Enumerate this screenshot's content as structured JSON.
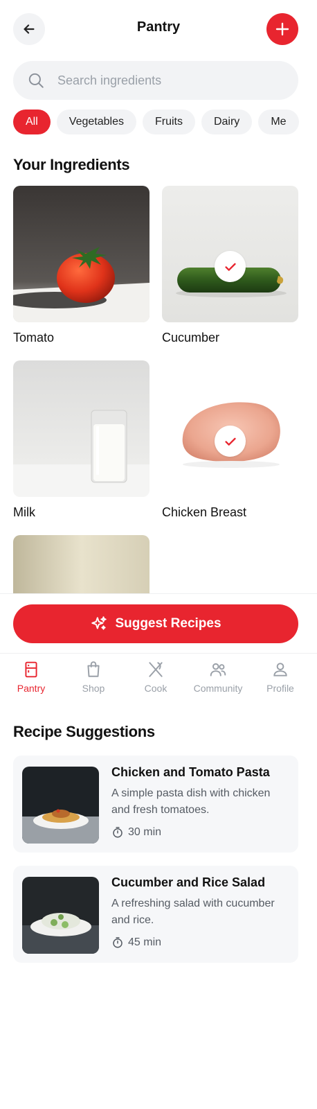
{
  "header": {
    "title": "Pantry",
    "back_icon": "arrow-left-icon",
    "add_icon": "plus-icon"
  },
  "search": {
    "placeholder": "Search ingredients",
    "value": ""
  },
  "filters": [
    {
      "label": "All",
      "active": true
    },
    {
      "label": "Vegetables",
      "active": false
    },
    {
      "label": "Fruits",
      "active": false
    },
    {
      "label": "Dairy",
      "active": false
    },
    {
      "label": "Me",
      "active": false
    }
  ],
  "ingredients": {
    "title": "Your Ingredients",
    "items": [
      {
        "name": "Tomato",
        "selected": false
      },
      {
        "name": "Cucumber",
        "selected": true
      },
      {
        "name": "Milk",
        "selected": false
      },
      {
        "name": "Chicken Breast",
        "selected": true
      }
    ]
  },
  "cta": {
    "label": "Suggest Recipes",
    "icon": "sparkles-icon"
  },
  "tabbar": {
    "items": [
      {
        "label": "Pantry",
        "icon": "fridge-icon",
        "active": true
      },
      {
        "label": "Shop",
        "icon": "shopping-bag-icon",
        "active": false
      },
      {
        "label": "Cook",
        "icon": "utensils-icon",
        "active": false
      },
      {
        "label": "Community",
        "icon": "users-icon",
        "active": false
      },
      {
        "label": "Profile",
        "icon": "user-icon",
        "active": false
      }
    ]
  },
  "recipes": {
    "title": "Recipe Suggestions",
    "items": [
      {
        "title": "Chicken and Tomato Pasta",
        "description": "A simple pasta dish with chicken and fresh tomatoes.",
        "time": "30 min"
      },
      {
        "title": "Cucumber and Rice Salad",
        "description": "A refreshing salad with cucumber and rice.",
        "time": "45 min"
      }
    ]
  },
  "colors": {
    "accent": "#e8252f",
    "chip_bg": "#f2f3f5",
    "muted_text": "#9aa0a8"
  }
}
